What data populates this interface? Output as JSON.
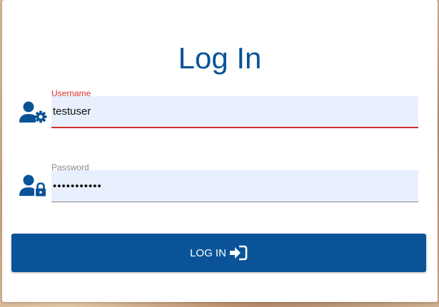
{
  "title": "Log In",
  "username": {
    "label": "Username",
    "value": "testuser",
    "icon": "user-gear-icon"
  },
  "password": {
    "label": "Password",
    "value": "•••••••••••",
    "icon": "user-lock-icon"
  },
  "login_button": {
    "label": "LOG IN",
    "icon": "sign-in-icon"
  },
  "colors": {
    "brand": "#0a5398",
    "error": "#d32f2f",
    "input_bg": "#e8f0fe"
  }
}
